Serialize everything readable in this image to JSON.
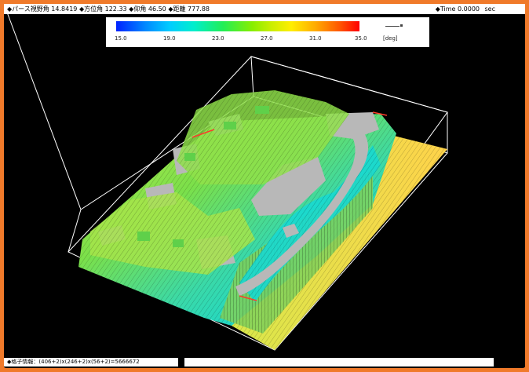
{
  "header": {
    "parse_angle": "◆パース視野角 14.8419",
    "azimuth": "◆方位角 122.33",
    "elevation": "◆仰角 46.50",
    "distance": "◆距離 777.88",
    "time": "◆Time 0.0000",
    "time_unit": "sec"
  },
  "legend": {
    "ticks": [
      "15.0",
      "19.0",
      "23.0",
      "27.0",
      "31.0",
      "35.0"
    ],
    "unit": "[deg]",
    "colors": [
      "#0022ff",
      "#00ccff",
      "#22ee55",
      "#ccee00",
      "#ffaa00",
      "#ff0000"
    ]
  },
  "footer": {
    "mesh_info": "◆格子情報：(406+2)x(246+2)x(56+2)=5666672"
  },
  "colors": {
    "background": "#000000",
    "border": "#f07a2a",
    "ground_low": "#18d8d0",
    "ground_mid": "#7be04a",
    "ground_high": "#f0e14a",
    "building": "#b8b8b8"
  }
}
